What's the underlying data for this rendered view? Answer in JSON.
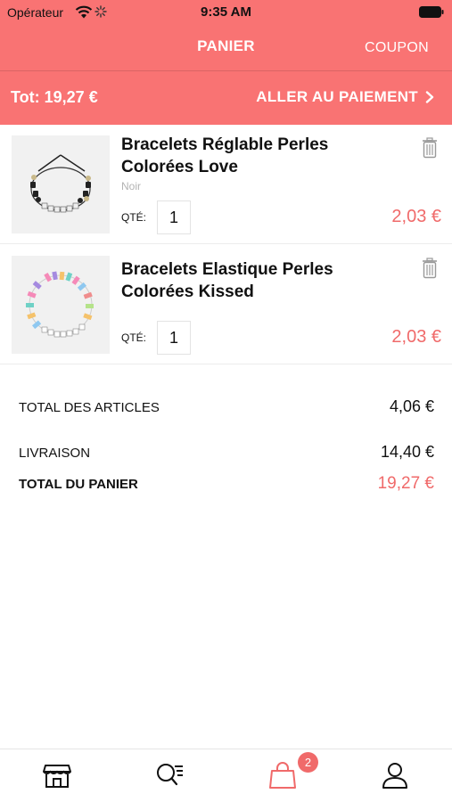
{
  "status_bar": {
    "carrier": "Opérateur",
    "time": "9:35 AM"
  },
  "nav": {
    "title": "PANIER",
    "coupon": "COUPON"
  },
  "summary_bar": {
    "total": "Tot: 19,27 €",
    "checkout": "ALLER AU PAIEMENT"
  },
  "items": [
    {
      "name": "Bracelets Réglable Perles Colorées Love",
      "variant": "Noir",
      "qty_label": "QTÉ:",
      "qty": "1",
      "price": "2,03 €",
      "image_icon": "black-bead-bracelet-image"
    },
    {
      "name": "Bracelets Elastique Perles Colorées Kissed",
      "variant": "",
      "qty_label": "QTÉ:",
      "qty": "1",
      "price": "2,03 €",
      "image_icon": "pastel-bead-bracelet-image"
    }
  ],
  "totals": {
    "articles_label": "TOTAL DES ARTICLES",
    "articles_value": "4,06 €",
    "shipping_label": "LIVRAISON",
    "shipping_value": "14,40 €",
    "cart_label": "TOTAL DU PANIER",
    "cart_value": "19,27 €"
  },
  "tab_bar": {
    "tabs": [
      {
        "icon": "store-icon"
      },
      {
        "icon": "search-list-icon"
      },
      {
        "icon": "shopping-bag-icon",
        "active": true
      },
      {
        "icon": "user-icon"
      }
    ],
    "cart_badge": "2"
  },
  "colors": {
    "accent": "#f97373",
    "price": "#f06a6a",
    "variant": "#b3b3b3"
  }
}
